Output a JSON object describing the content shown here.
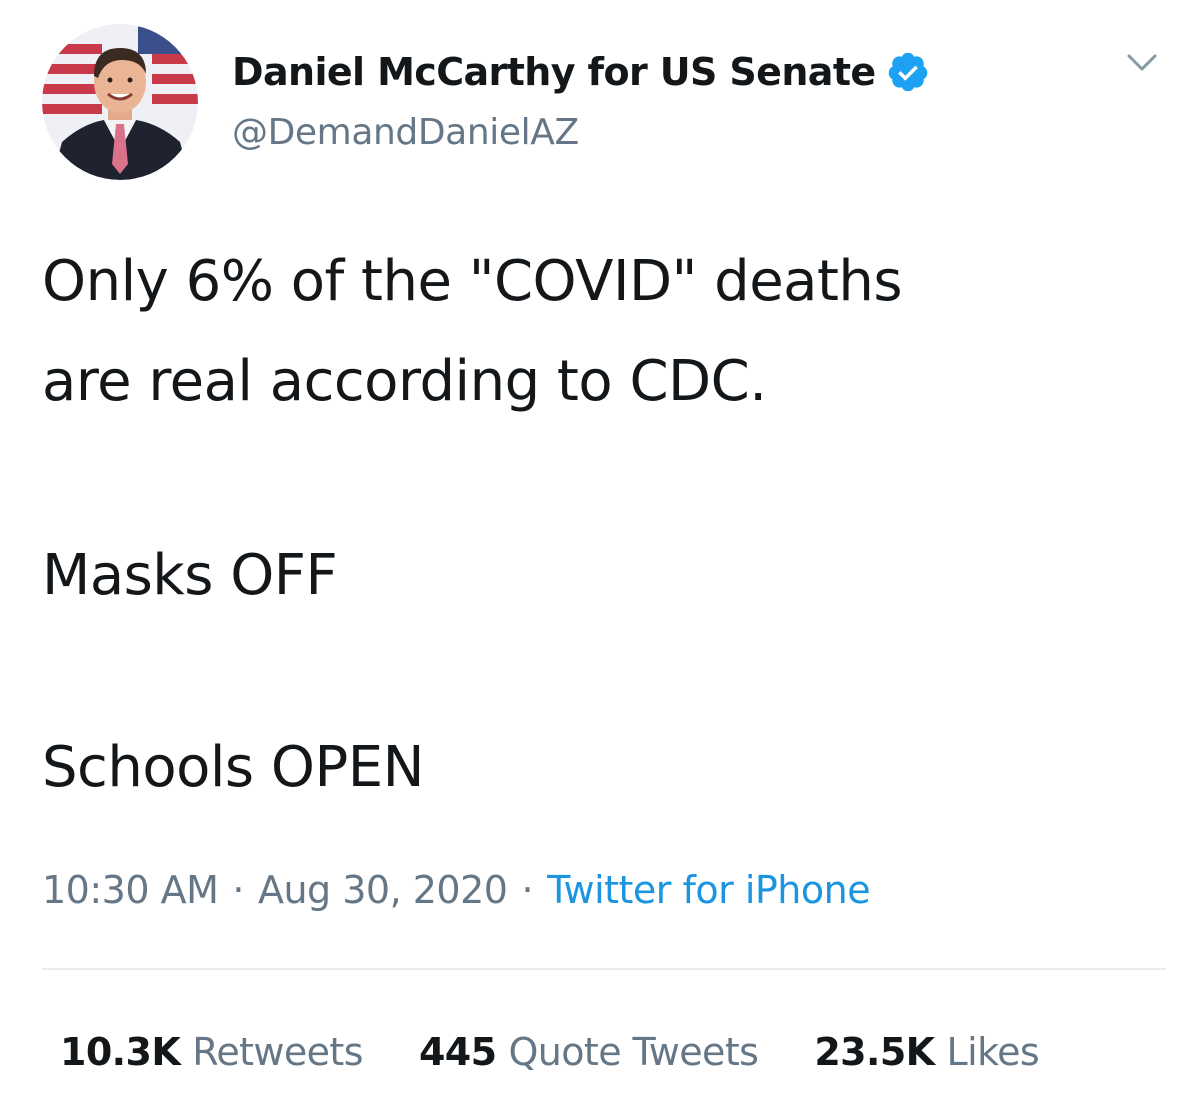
{
  "author": {
    "display_name": "Daniel McCarthy for US Senate",
    "handle": "@DemandDanielAZ",
    "verified_icon": "verified-badge-icon",
    "avatar_icon": "profile-photo"
  },
  "menu": {
    "icon": "chevron-down-icon"
  },
  "tweet": {
    "lines": [
      "Only 6% of the \"COVID\" deaths",
      "are real according to CDC.",
      "Masks OFF",
      "Schools OPEN"
    ]
  },
  "meta": {
    "time": "10:30 AM",
    "separator": "·",
    "date": "Aug 30, 2020",
    "source": "Twitter for iPhone"
  },
  "stats": {
    "retweets": {
      "count": "10.3K",
      "label": "Retweets"
    },
    "quotes": {
      "count": "445",
      "label": "Quote Tweets"
    },
    "likes": {
      "count": "23.5K",
      "label": "Likes"
    }
  },
  "colors": {
    "text": "#14171a",
    "secondary": "#657786",
    "link": "#1b95e0",
    "verified": "#1da1f2",
    "divider": "#e6ecf0"
  }
}
